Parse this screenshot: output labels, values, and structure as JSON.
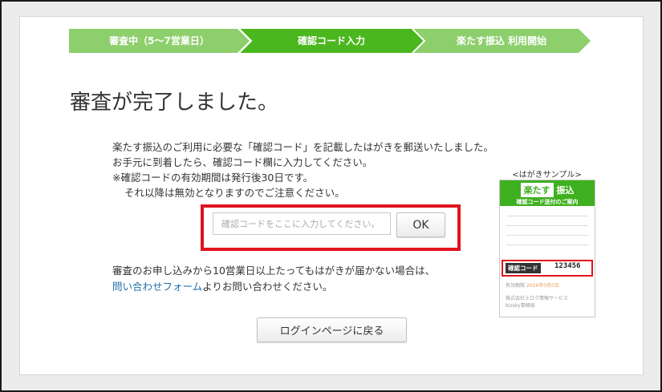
{
  "steps": [
    {
      "label": "審査中（5～7営業日）",
      "state": "done"
    },
    {
      "label": "確認コード入力",
      "state": "active"
    },
    {
      "label": "楽たす振込 利用開始",
      "state": "todo"
    }
  ],
  "colors": {
    "step_done": "#8dcf6c",
    "step_active": "#4bb71f",
    "step_todo": "#8dcf6c",
    "highlight": "#e0141e",
    "link": "#1f6ea8"
  },
  "page_title": "審査が完了しました。",
  "message": {
    "line1": "楽たす振込のご利用に必要な「確認コード」を記載したはがきを郵送いたしました。",
    "line2": "お手元に到着したら、確認コード欄に入力してください。",
    "line3": "※確認コードの有効期間は発行後30日です。",
    "line4": "それ以降は無効となりますのでご注意ください。"
  },
  "code_form": {
    "placeholder": "確認コードをここに入力してください。",
    "value": "",
    "ok_label": "OK"
  },
  "note": {
    "line1": "審査のお申し込みから10営業日以上たってもはがきが届かない場合は、",
    "link_text": "問い合わせフォーム",
    "line2_rest": "よりお問い合わせください。"
  },
  "login_button": "ログインページに戻る",
  "sample": {
    "caption": "<はがきサンプル>",
    "brand_box": "楽たす",
    "brand_rest": "振込",
    "subtitle": "確認コード送付のご案内",
    "code_label": "確認コード",
    "code_value": "123456",
    "expiry_label": "有効期限",
    "expiry_value": "2016年0月0日",
    "company1": "株式会社ミロク情報サービス",
    "company2": "bizsky事務局"
  }
}
